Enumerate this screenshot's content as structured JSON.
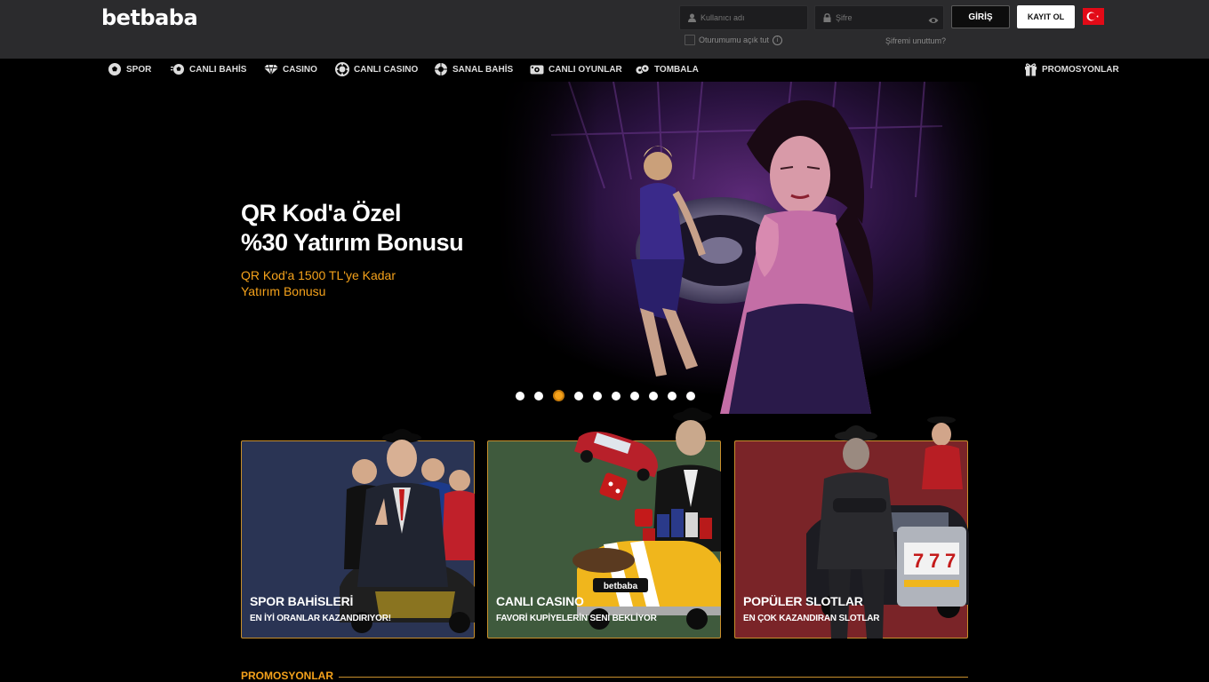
{
  "header": {
    "logo": "betbaba",
    "username_placeholder": "Kullanıcı adı",
    "password_placeholder": "Şifre",
    "login_label": "GİRİŞ",
    "register_label": "KAYIT OL",
    "remember_label": "Oturumumu açık tut",
    "forgot_label": "Şifremi unuttum?",
    "language_flag": "turkey-flag"
  },
  "nav": {
    "items": [
      {
        "label": "SPOR",
        "icon": "soccer-ball-icon"
      },
      {
        "label": "CANLI BAHİS",
        "icon": "live-ball-icon"
      },
      {
        "label": "CASINO",
        "icon": "diamond-icon"
      },
      {
        "label": "CANLI CASINO",
        "icon": "casino-chip-icon"
      },
      {
        "label": "SANAL BAHİS",
        "icon": "virtual-ball-icon"
      },
      {
        "label": "CANLI OYUNLAR",
        "icon": "gamepad-icon"
      },
      {
        "label": "TOMBALA",
        "icon": "lottery-balls-icon"
      }
    ],
    "promotions": {
      "label": "PROMOSYONLAR",
      "icon": "gift-icon"
    }
  },
  "hero": {
    "title_line1": "QR Kod'a Özel",
    "title_line2": "%30 Yatırım Bonusu",
    "subtitle_line1": "QR Kod'a 1500 TL'ye Kadar",
    "subtitle_line2": "Yatırım Bonusu",
    "slide_count": 10,
    "active_slide": 3,
    "accent": "#f5a21b"
  },
  "cards": [
    {
      "title": "SPOR BAHİSLERİ",
      "subtitle": "EN İYİ ORANLAR KAZANDIRIYOR!",
      "color": "#2a3454"
    },
    {
      "title": "CANLI CASINO",
      "subtitle": "FAVORİ KUPİYELERİN SENİ BEKLİYOR",
      "color": "#3f5a3d"
    },
    {
      "title": "POPÜLER SLOTLAR",
      "subtitle": "EN ÇOK KAZANDIRAN SLOTLAR",
      "color": "#7a2428"
    }
  ],
  "section": {
    "promotions_title": "PROMOSYONLAR"
  },
  "colors": {
    "topbar": "#2b2b2d",
    "background": "#000000",
    "accent": "#f5a21b",
    "card_border": "#c88f2c"
  }
}
